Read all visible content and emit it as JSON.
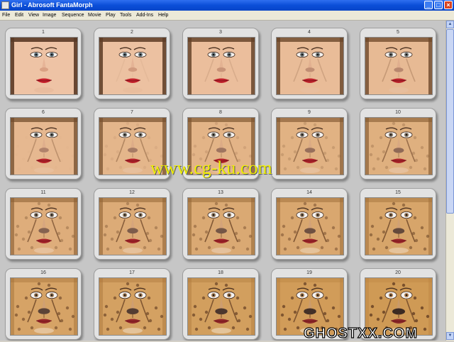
{
  "window": {
    "title": "Girl - Abrosoft FantaMorph"
  },
  "menu": [
    {
      "label": "File"
    },
    {
      "label": "Edit"
    },
    {
      "label": "View"
    },
    {
      "label": "Image"
    },
    {
      "label": "Sequence"
    },
    {
      "label": "Movie"
    },
    {
      "label": "Play"
    },
    {
      "label": "Tools"
    },
    {
      "label": "Add-Ins"
    },
    {
      "label": "Help"
    }
  ],
  "frames": [
    {
      "number": "1",
      "morph": 0.0
    },
    {
      "number": "2",
      "morph": 0.05
    },
    {
      "number": "3",
      "morph": 0.11
    },
    {
      "number": "4",
      "morph": 0.16
    },
    {
      "number": "5",
      "morph": 0.21
    },
    {
      "number": "6",
      "morph": 0.26
    },
    {
      "number": "7",
      "morph": 0.32
    },
    {
      "number": "8",
      "morph": 0.37
    },
    {
      "number": "9",
      "morph": 0.42
    },
    {
      "number": "10",
      "morph": 0.47
    },
    {
      "number": "11",
      "morph": 0.53
    },
    {
      "number": "12",
      "morph": 0.58
    },
    {
      "number": "13",
      "morph": 0.63
    },
    {
      "number": "14",
      "morph": 0.68
    },
    {
      "number": "15",
      "morph": 0.74
    },
    {
      "number": "16",
      "morph": 0.79
    },
    {
      "number": "17",
      "morph": 0.84
    },
    {
      "number": "18",
      "morph": 0.89
    },
    {
      "number": "19",
      "morph": 0.95
    },
    {
      "number": "20",
      "morph": 1.0
    }
  ],
  "overlay": {
    "watermark": "www.cg-ku.com",
    "brand": "GHOSTXX.COM"
  },
  "colors": {
    "skin": "#eec3a5",
    "fur": "#cf9a55",
    "spot": "#6a4326",
    "lip": "#c8202c",
    "accent": "#0a4ed8"
  }
}
